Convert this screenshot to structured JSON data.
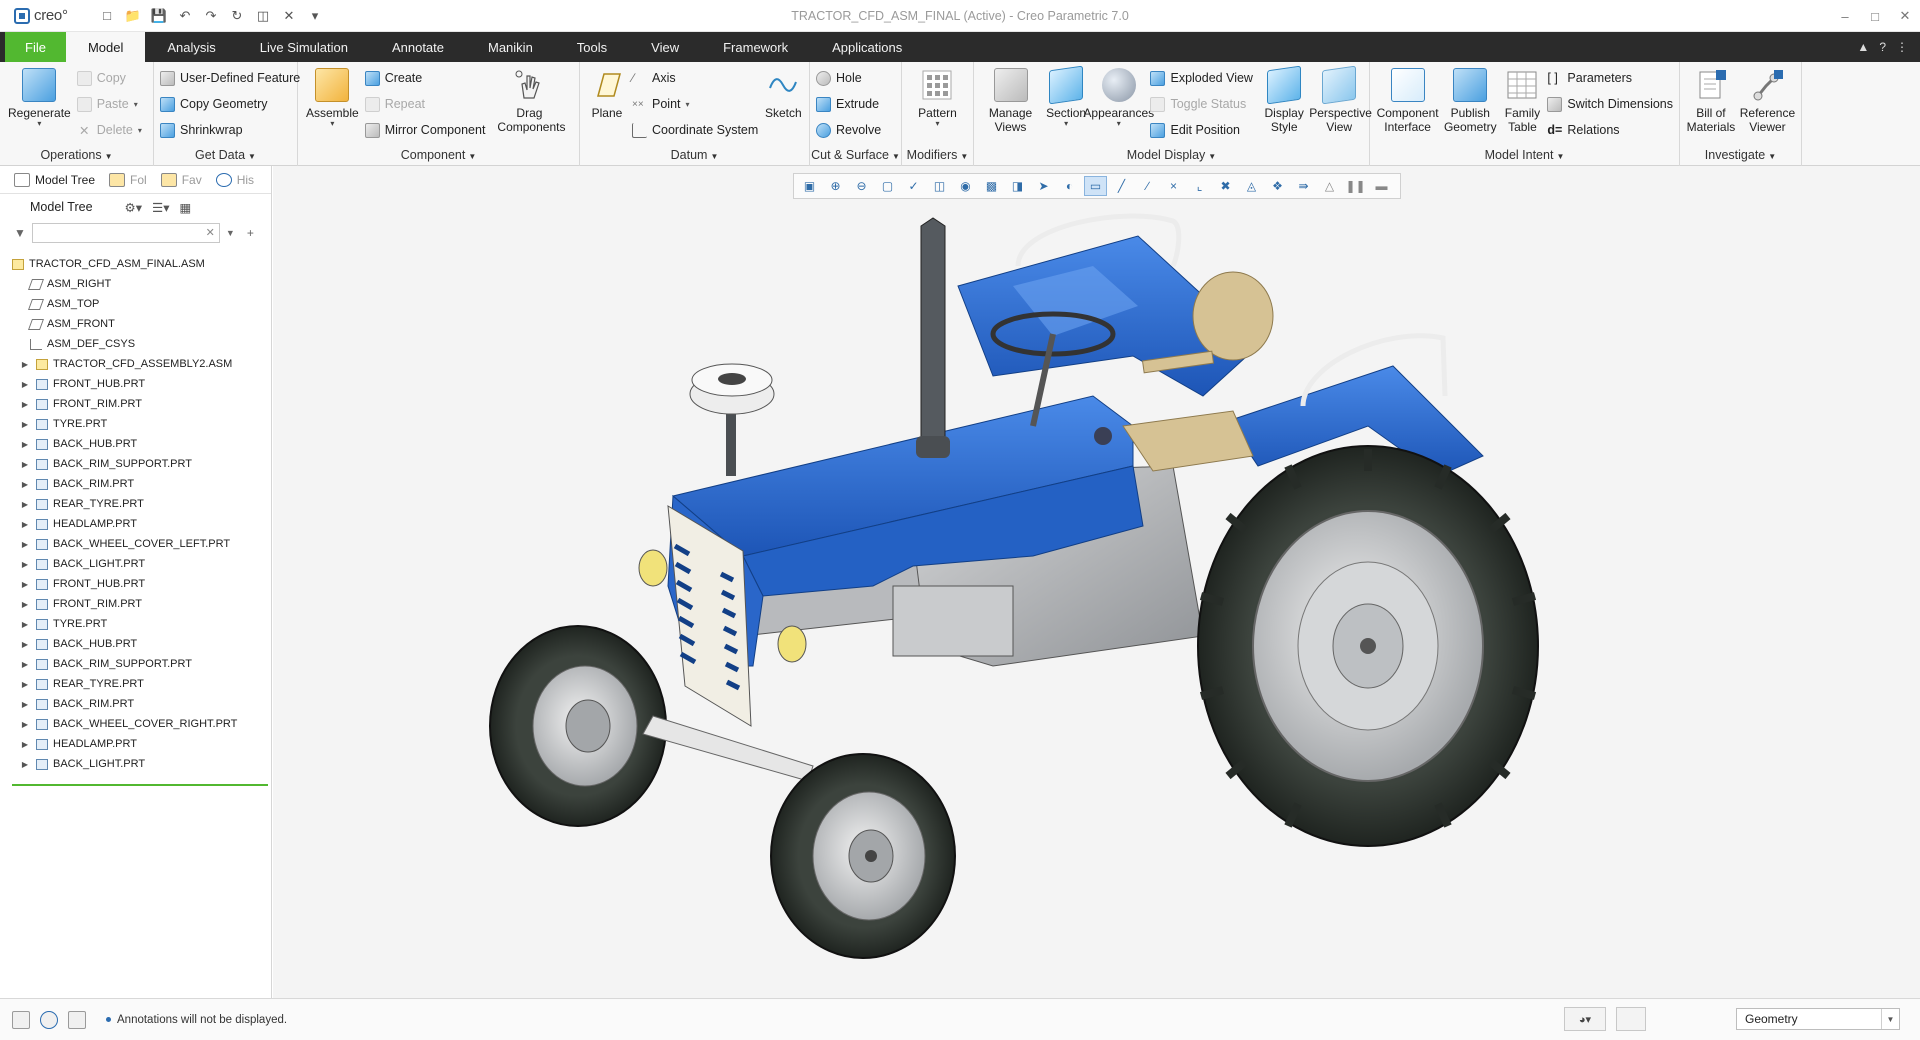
{
  "app": {
    "logo_text": "creo°",
    "window_title": "TRACTOR_CFD_ASM_FINAL (Active) - Creo Parametric 7.0"
  },
  "tabs": [
    "File",
    "Model",
    "Analysis",
    "Live Simulation",
    "Annotate",
    "Manikin",
    "Tools",
    "View",
    "Framework",
    "Applications"
  ],
  "active_tab": "Model",
  "ribbon": {
    "operations": {
      "label": "Operations",
      "regenerate": "Regenerate",
      "copy": "Copy",
      "paste": "Paste",
      "delete": "Delete"
    },
    "get_data": {
      "label": "Get Data",
      "udf": "User-Defined Feature",
      "copy_geometry": "Copy Geometry",
      "shrinkwrap": "Shrinkwrap"
    },
    "component": {
      "label": "Component",
      "assemble": "Assemble",
      "create": "Create",
      "repeat": "Repeat",
      "mirror": "Mirror Component",
      "drag": "Drag Components"
    },
    "datum": {
      "label": "Datum",
      "plane": "Plane",
      "axis": "Axis",
      "point": "Point",
      "csys": "Coordinate System",
      "sketch": "Sketch"
    },
    "cut_surface": {
      "label": "Cut & Surface",
      "hole": "Hole",
      "extrude": "Extrude",
      "revolve": "Revolve"
    },
    "modifiers": {
      "label": "Modifiers",
      "pattern": "Pattern"
    },
    "model_display": {
      "label": "Model Display",
      "manage_views": "Manage Views",
      "section": "Section",
      "appearances": "Appearances",
      "exploded_view": "Exploded View",
      "toggle_status": "Toggle Status",
      "edit_position": "Edit Position",
      "display_style": "Display Style",
      "perspective_view": "Perspective View"
    },
    "model_intent": {
      "label": "Model Intent",
      "component_interface": "Component Interface",
      "publish_geometry": "Publish Geometry",
      "family_table": "Family Table",
      "parameters": "Parameters",
      "switch_dimensions": "Switch Dimensions",
      "relations": "Relations"
    },
    "investigate": {
      "label": "Investigate",
      "bom": "Bill of Materials",
      "reference_viewer": "Reference Viewer"
    }
  },
  "navigator": {
    "tabs": [
      "Model Tree",
      "Fol",
      "Fav",
      "His"
    ],
    "tree_title": "Model Tree",
    "search_placeholder": "",
    "root": "TRACTOR_CFD_ASM_FINAL.ASM",
    "items": [
      {
        "name": "ASM_RIGHT",
        "type": "plane",
        "expandable": false
      },
      {
        "name": "ASM_TOP",
        "type": "plane",
        "expandable": false
      },
      {
        "name": "ASM_FRONT",
        "type": "plane",
        "expandable": false
      },
      {
        "name": "ASM_DEF_CSYS",
        "type": "csys",
        "expandable": false
      },
      {
        "name": "TRACTOR_CFD_ASSEMBLY2.ASM",
        "type": "asm",
        "expandable": true
      },
      {
        "name": "FRONT_HUB.PRT",
        "type": "prt",
        "expandable": true
      },
      {
        "name": "FRONT_RIM.PRT",
        "type": "prt",
        "expandable": true
      },
      {
        "name": "TYRE.PRT",
        "type": "prt",
        "expandable": true
      },
      {
        "name": "BACK_HUB.PRT",
        "type": "prt",
        "expandable": true
      },
      {
        "name": "BACK_RIM_SUPPORT.PRT",
        "type": "prt",
        "expandable": true
      },
      {
        "name": "BACK_RIM.PRT",
        "type": "prt",
        "expandable": true
      },
      {
        "name": "REAR_TYRE.PRT",
        "type": "prt",
        "expandable": true
      },
      {
        "name": "HEADLAMP.PRT",
        "type": "prt",
        "expandable": true
      },
      {
        "name": "BACK_WHEEL_COVER_LEFT.PRT",
        "type": "prt",
        "expandable": true
      },
      {
        "name": "BACK_LIGHT.PRT",
        "type": "prt",
        "expandable": true
      },
      {
        "name": "FRONT_HUB.PRT",
        "type": "prt",
        "expandable": true
      },
      {
        "name": "FRONT_RIM.PRT",
        "type": "prt",
        "expandable": true
      },
      {
        "name": "TYRE.PRT",
        "type": "prt",
        "expandable": true
      },
      {
        "name": "BACK_HUB.PRT",
        "type": "prt",
        "expandable": true
      },
      {
        "name": "BACK_RIM_SUPPORT.PRT",
        "type": "prt",
        "expandable": true
      },
      {
        "name": "REAR_TYRE.PRT",
        "type": "prt",
        "expandable": true
      },
      {
        "name": "BACK_RIM.PRT",
        "type": "prt",
        "expandable": true
      },
      {
        "name": "BACK_WHEEL_COVER_RIGHT.PRT",
        "type": "prt",
        "expandable": true
      },
      {
        "name": "HEADLAMP.PRT",
        "type": "prt",
        "expandable": true
      },
      {
        "name": "BACK_LIGHT.PRT",
        "type": "prt",
        "expandable": true
      }
    ]
  },
  "status": {
    "message": "Annotations will not be displayed.",
    "filter_value": "Geometry"
  },
  "colors": {
    "file_tab": "#52b830",
    "tractor_body": "#2f6fd0",
    "tyre": "#343a36"
  }
}
